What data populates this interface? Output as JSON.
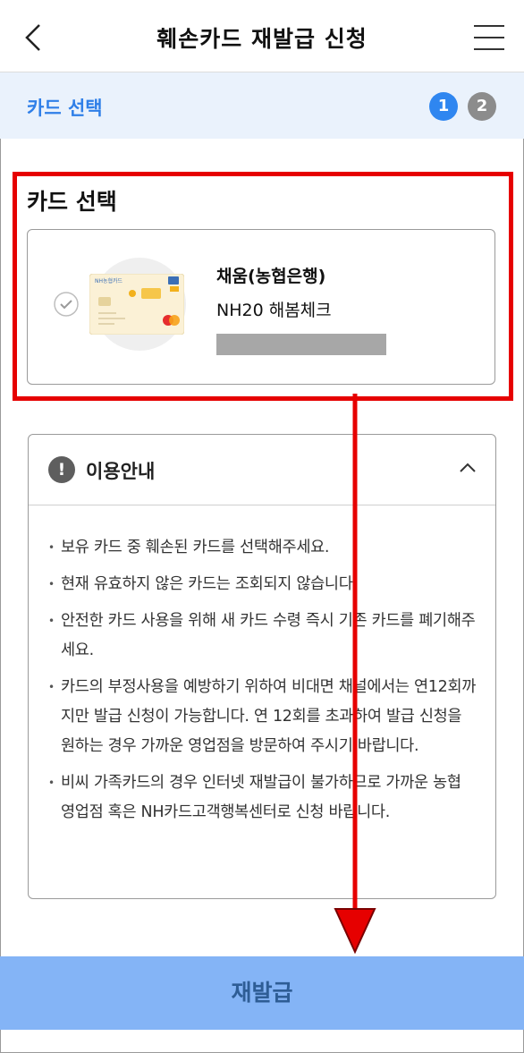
{
  "header": {
    "title": "훼손카드 재발급 신청"
  },
  "steps": {
    "label": "카드 선택",
    "items": [
      "1",
      "2"
    ],
    "current": 1
  },
  "card_section": {
    "title": "카드 선택",
    "card": {
      "bank": "채움(농협은행)",
      "name": "NH20 해봄체크"
    }
  },
  "info": {
    "title": "이용안내",
    "notes": [
      "보유 카드 중 훼손된 카드를 선택해주세요.",
      "현재 유효하지 않은 카드는 조회되지 않습니다.",
      "안전한 카드 사용을 위해 새 카드 수령 즉시 기존 카드를 폐기해주세요.",
      "카드의 부정사용을 예방하기 위하여 비대면 채널에서는 연12회까지만 발급 신청이 가능합니다. 연 12회를 초과하여 발급 신청을 원하는 경우 가까운 영업점을 방문하여 주시기 바랍니다.",
      "비씨 가족카드의 경우 인터넷 재발급이 불가하므로 가까운 농협 영업점 혹은 NH카드고객행복센터로 신청 바랍니다."
    ]
  },
  "button": {
    "label": "재발급"
  },
  "colors": {
    "accent": "#2f86f0",
    "annotation": "#e60000",
    "button_bg": "#84b4f6"
  }
}
